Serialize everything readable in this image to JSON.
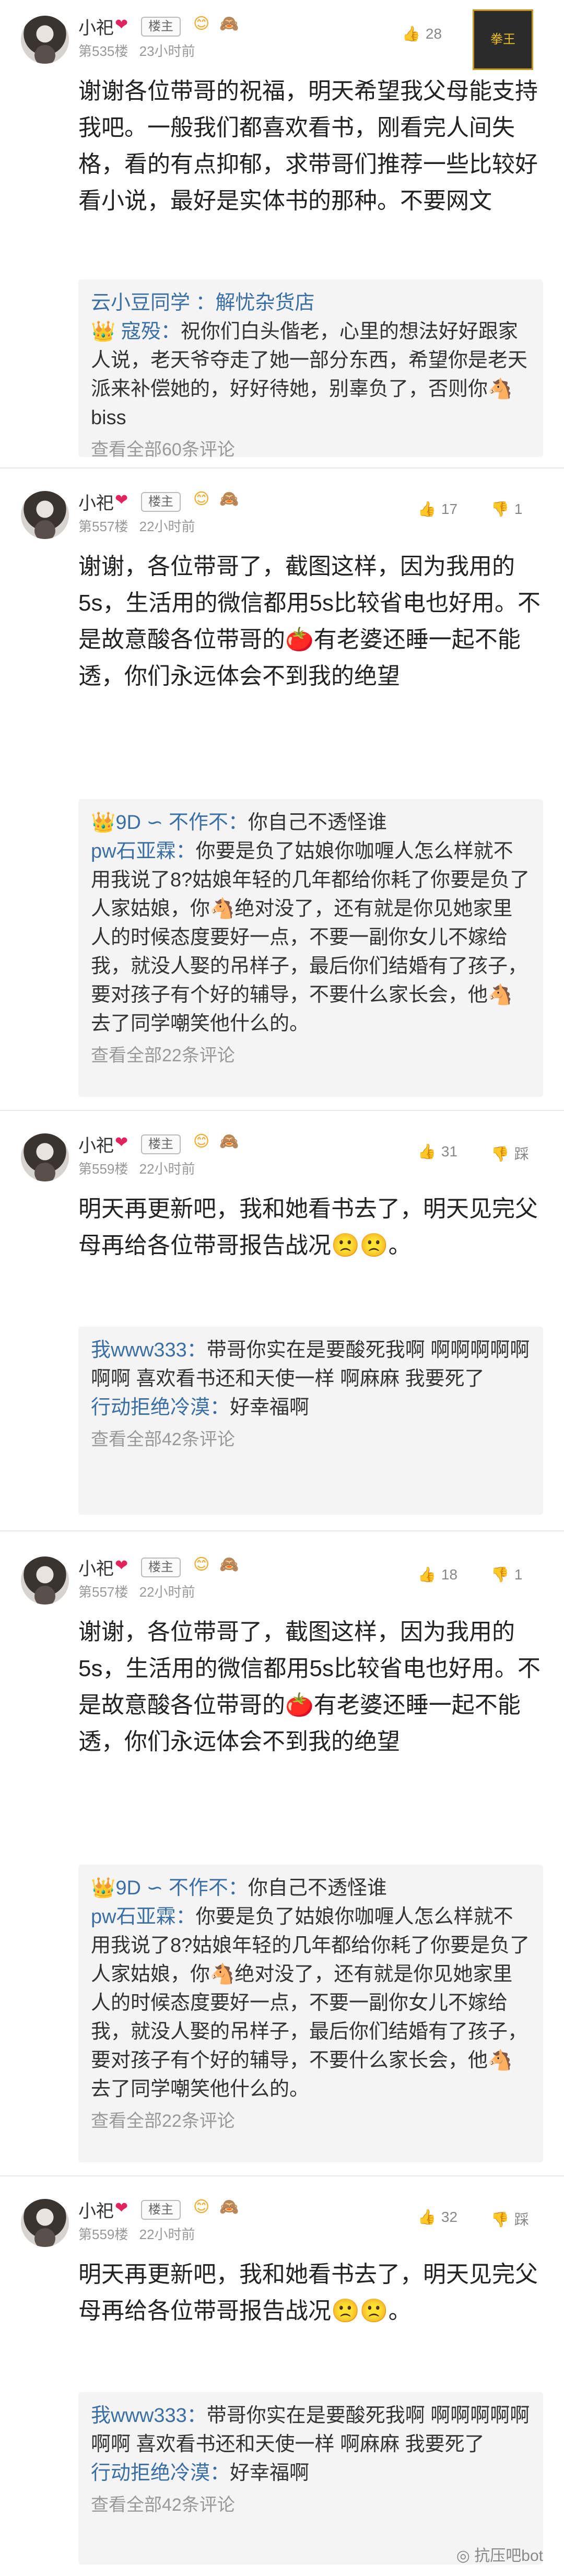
{
  "posts": [
    {
      "username": "小祀",
      "role": "楼主",
      "floor": "第535楼",
      "time": "23小时前",
      "like_count": "28",
      "dislike_count": "",
      "body": "谢谢各位带哥的祝福，明天希望我父母能支持我吧。一般我们都喜欢看书，刚看完人间失格，看的有点抑郁，求带哥们推荐一些比较好看小说，最好是实体书的那种。不要网文",
      "replies": [
        {
          "user": "云小豆同学",
          "to": "解忧杂货店",
          "text": "",
          "prefix": "云小豆同学 ：解忧杂货店"
        },
        {
          "user": "寇殁",
          "to": "",
          "text": "祝你们白头偕老，心里的想法好好跟家人说，老天爷夺走了她一部分东西，希望你是老天派来补偿她的，好好待她，别辜负了，否则你🐴biss"
        }
      ],
      "more": "查看全部60条评论"
    },
    {
      "username": "小祀",
      "role": "楼主",
      "floor": "第557楼",
      "time": "22小时前",
      "like_count": "17",
      "dislike_count": "1",
      "body": "谢谢，各位带哥了，截图这样，因为我用的5s，生活用的微信都用5s比较省电也好用。不是故意酸各位带哥的🍅有老婆还睡一起不能透，你们永远体会不到我的绝望",
      "replies": [
        {
          "user": "9D ∽ 不作不",
          "to": "",
          "text": "你自己不透怪谁"
        },
        {
          "user": "pw石亚霖",
          "to": "",
          "text": "你要是负了姑娘你咖喱人怎么样就不用我说了8?姑娘年轻的几年都给你耗了你要是负了人家姑娘，你🐴绝对没了，还有就是你见她家里人的时候态度要好一点，不要一副你女儿不嫁给我，就没人娶的吊样子，最后你们结婚有了孩子，要对孩子有个好的辅导，不要什么家长会，他🐴去了同学嘲笑他什么的。"
        }
      ],
      "more": "查看全部22条评论"
    },
    {
      "username": "小祀",
      "role": "楼主",
      "floor": "第559楼",
      "time": "22小时前",
      "like_count": "31",
      "dislike_count": "踩",
      "body": "明天再更新吧，我和她看书去了，明天见完父母再给各位带哥报告战况🙁🙁。",
      "replies": [
        {
          "user": "我www333",
          "to": "",
          "text": "带哥你实在是要酸死我啊 啊啊啊啊啊啊啊 喜欢看书还和天使一样 啊麻麻 我要死了"
        },
        {
          "user": "行动拒绝冷漠",
          "to": "",
          "text": "好幸福啊"
        }
      ],
      "more": "查看全部42条评论"
    },
    {
      "username": "小祀",
      "role": "楼主",
      "floor": "第557楼",
      "time": "22小时前",
      "like_count": "18",
      "dislike_count": "1",
      "body": "谢谢，各位带哥了，截图这样，因为我用的5s，生活用的微信都用5s比较省电也好用。不是故意酸各位带哥的🍅有老婆还睡一起不能透，你们永远体会不到我的绝望",
      "replies": [
        {
          "user": "9D ∽ 不作不",
          "to": "",
          "text": "你自己不透怪谁"
        },
        {
          "user": "pw石亚霖",
          "to": "",
          "text": "你要是负了姑娘你咖喱人怎么样就不用我说了8?姑娘年轻的几年都给你耗了你要是负了人家姑娘，你🐴绝对没了，还有就是你见她家里人的时候态度要好一点，不要一副你女儿不嫁给我，就没人娶的吊样子，最后你们结婚有了孩子，要对孩子有个好的辅导，不要什么家长会，他🐴去了同学嘲笑他什么的。"
        }
      ],
      "more": "查看全部22条评论"
    },
    {
      "username": "小祀",
      "role": "楼主",
      "floor": "第559楼",
      "time": "22小时前",
      "like_count": "32",
      "dislike_count": "踩",
      "body": "明天再更新吧，我和她看书去了，明天见完父母再给各位带哥报告战况🙁🙁。",
      "replies": [
        {
          "user": "我www333",
          "to": "",
          "text": "带哥你实在是要酸死我啊 啊啊啊啊啊啊啊 喜欢看书还和天使一样 啊麻麻 我要死了"
        },
        {
          "user": "行动拒绝冷漠",
          "to": "",
          "text": "好幸福啊"
        }
      ],
      "more": "查看全部42条评论"
    }
  ],
  "watermark": "抗压吧bot",
  "trophy_text": "拳王"
}
